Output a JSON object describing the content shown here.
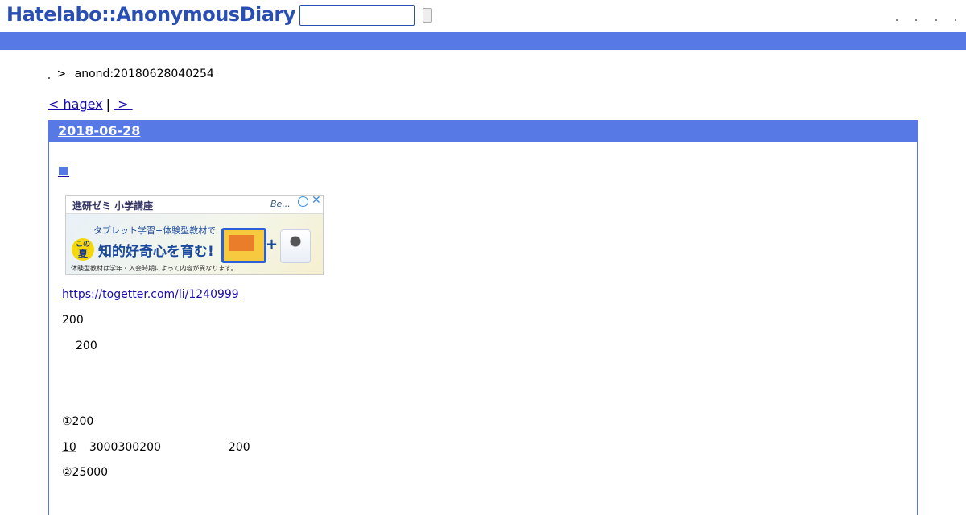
{
  "header": {
    "logo": "Hatelabo::AnonymousDiary",
    "search_value": "",
    "search_button_label": ""
  },
  "breadcrumb": {
    "separator": ">",
    "current": "anond:20180628040254"
  },
  "nav": {
    "prev_label": "< hagex",
    "separator": "|",
    "next_label": ">"
  },
  "day": {
    "date": "2018-06-28"
  },
  "ad": {
    "title": "進研ゼミ 小学講座",
    "brand": "Be...",
    "info": "i",
    "close": "✕",
    "line1": "タブレット学習+体験型教材で",
    "badge_top": "この",
    "badge_main": "夏",
    "line2": "知的好奇心を育む!",
    "plus": "+",
    "footnote": "体験型教材は学年・入会時期によって内容が異なります。"
  },
  "entry": {
    "link": "https://togetter.com/li/1240999",
    "line1": "200",
    "line2": "200",
    "item1": "①200",
    "row_ten": "10",
    "row_num": "3000300200",
    "row_num2": "200",
    "item2": "②25000"
  },
  "colors": {
    "accent": "#5779e6",
    "logo": "#2a4fb3",
    "link": "#1a0dab"
  }
}
